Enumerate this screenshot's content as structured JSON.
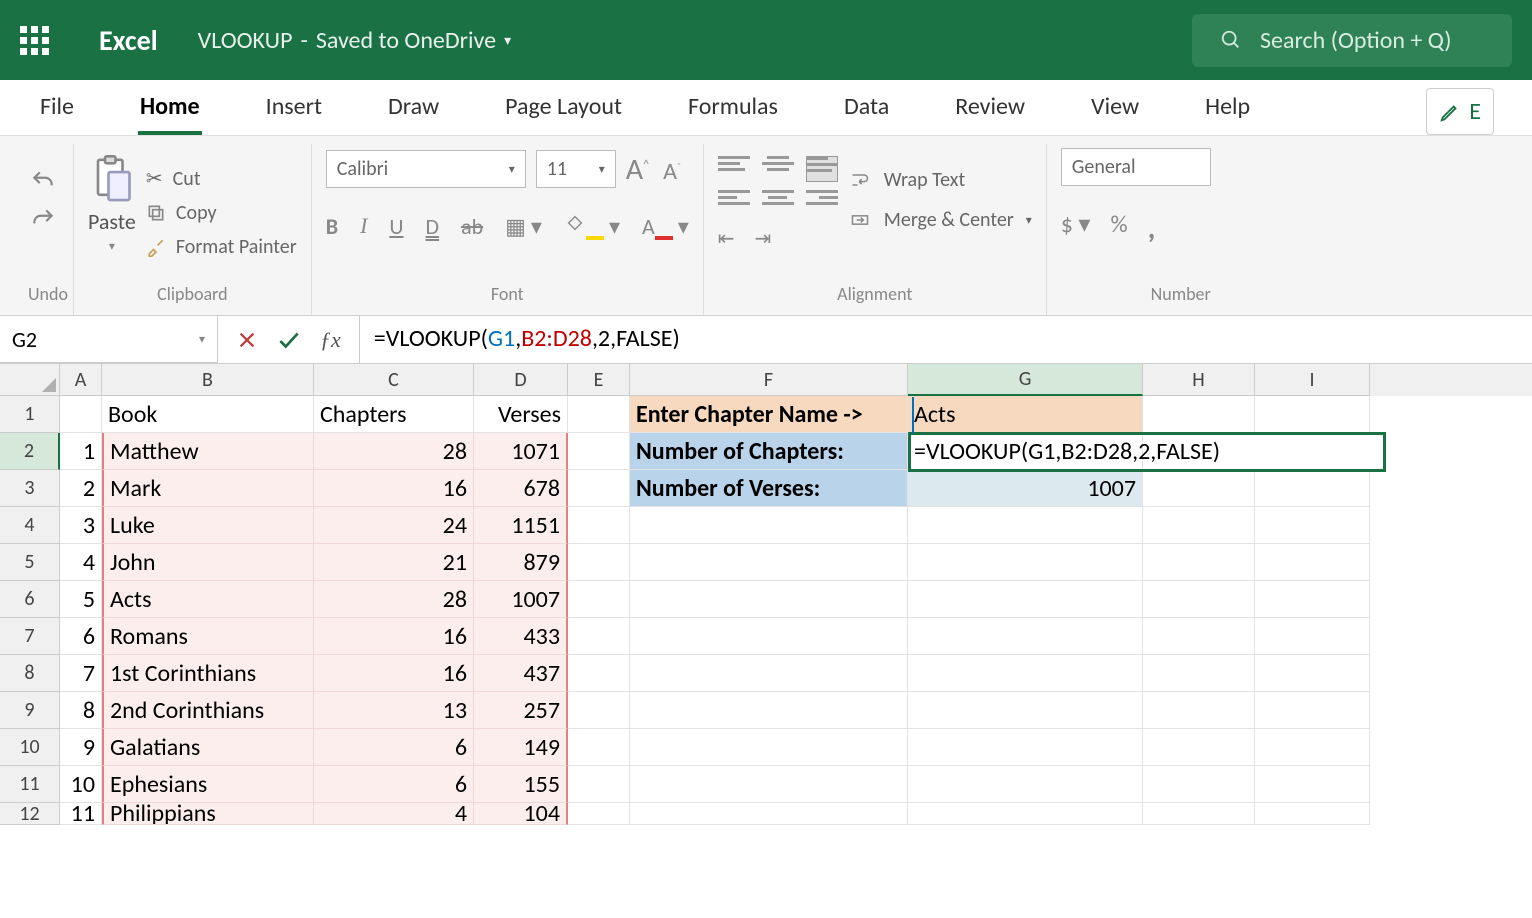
{
  "titlebar": {
    "appName": "Excel",
    "docName": "VLOOKUP",
    "saveStatus": "Saved to OneDrive",
    "searchPlaceholder": "Search (Option + Q)"
  },
  "tabs": [
    "File",
    "Home",
    "Insert",
    "Draw",
    "Page Layout",
    "Formulas",
    "Data",
    "Review",
    "View",
    "Help"
  ],
  "activeTab": "Home",
  "editing": "E",
  "ribbon": {
    "undoLabel": "Undo",
    "paste": "Paste",
    "cut": "Cut",
    "copy": "Copy",
    "formatPainter": "Format Painter",
    "clipboard": "Clipboard",
    "fontName": "Calibri",
    "fontSize": "11",
    "fontLabel": "Font",
    "wrapText": "Wrap Text",
    "mergeCenter": "Merge & Center",
    "alignment": "Alignment",
    "numberFormat": "General",
    "numberLabel": "Number"
  },
  "formulaBar": {
    "nameBox": "G2",
    "formula": "=VLOOKUP(G1,B2:D28,2,FALSE)",
    "parts": {
      "p1": "=VLOOKUP(",
      "g1": "G1",
      "c1": ",",
      "b2": "B2:D28",
      "rest": ",2,FALSE)"
    }
  },
  "columns": [
    "A",
    "B",
    "C",
    "D",
    "E",
    "F",
    "G",
    "H",
    "I"
  ],
  "headers": {
    "book": "Book",
    "chapters": "Chapters",
    "verses": "Verses"
  },
  "tableRows": [
    {
      "n": 1,
      "book": "Matthew",
      "ch": 28,
      "v": 1071
    },
    {
      "n": 2,
      "book": "Mark",
      "ch": 16,
      "v": 678
    },
    {
      "n": 3,
      "book": "Luke",
      "ch": 24,
      "v": 1151
    },
    {
      "n": 4,
      "book": "John",
      "ch": 21,
      "v": 879
    },
    {
      "n": 5,
      "book": "Acts",
      "ch": 28,
      "v": 1007
    },
    {
      "n": 6,
      "book": "Romans",
      "ch": 16,
      "v": 433
    },
    {
      "n": 7,
      "book": "1st Corinthians",
      "ch": 16,
      "v": 437
    },
    {
      "n": 8,
      "book": "2nd Corinthians",
      "ch": 13,
      "v": 257
    },
    {
      "n": 9,
      "book": "Galatians",
      "ch": 6,
      "v": 149
    },
    {
      "n": 10,
      "book": "Ephesians",
      "ch": 6,
      "v": 155
    },
    {
      "n": 11,
      "book": "Philippians",
      "ch": 4,
      "v": 104
    }
  ],
  "lookup": {
    "enterLabel": "Enter Chapter Name ->",
    "chapterValue": "Acts",
    "numChaptersLabel": "Number of Chapters:",
    "numVersesLabel": "Number of Verses:",
    "g2Formula": "=VLOOKUP(G1,B2:D28,2,FALSE)",
    "versesValue": "1007"
  }
}
